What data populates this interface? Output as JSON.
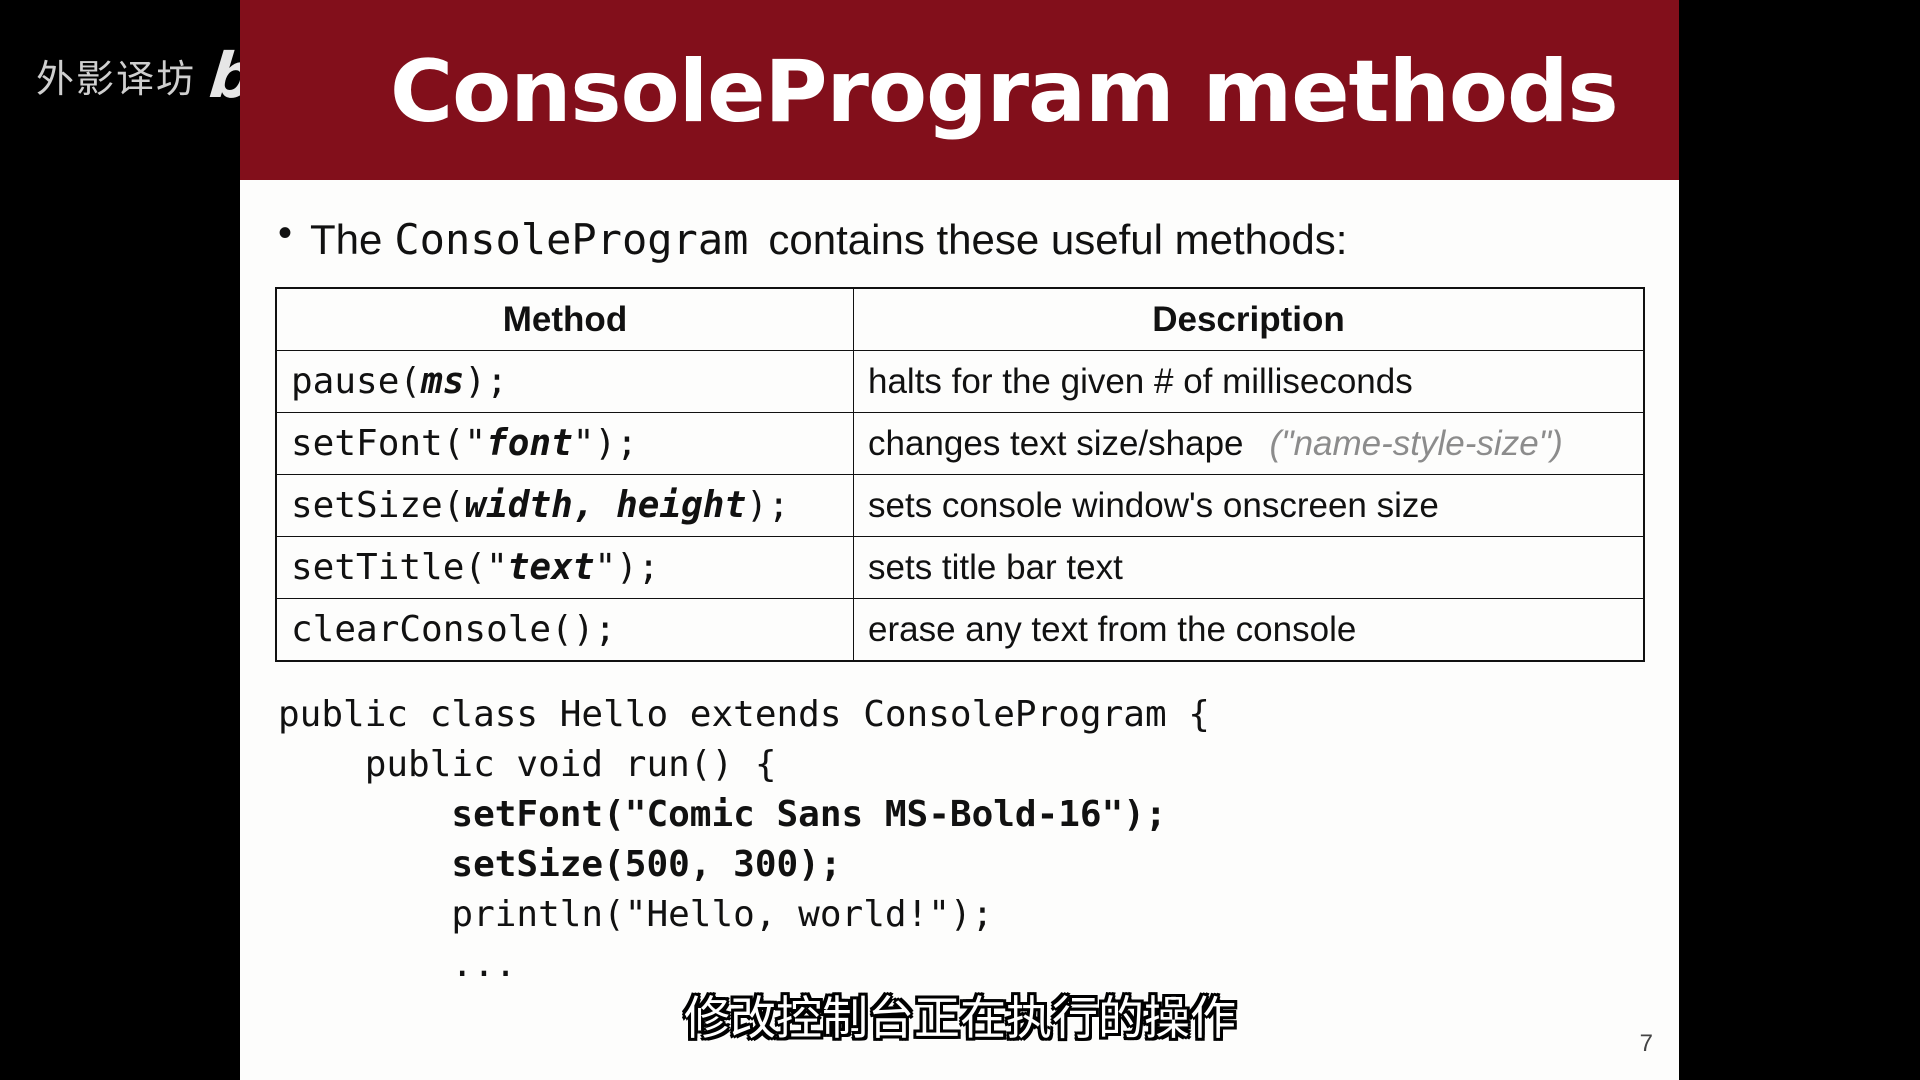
{
  "watermark": {
    "channel": "外影译坊",
    "logo": "bilibili"
  },
  "slide": {
    "title": "ConsoleProgram methods",
    "bullet": {
      "before": "The",
      "code": "ConsoleProgram",
      "after": "contains these useful methods:"
    },
    "table": {
      "headers": [
        "Method",
        "Description"
      ],
      "rows": [
        {
          "method": {
            "pre": "pause(",
            "arg": "ms",
            "post": ");"
          },
          "description": "halts for the given # of milliseconds",
          "note": ""
        },
        {
          "method": {
            "pre": "setFont(\"",
            "arg": "font",
            "post": "\");"
          },
          "description": "changes text size/shape",
          "note": "(\"name-style-size\")"
        },
        {
          "method": {
            "pre": "setSize(",
            "arg": "width, height",
            "post": ");"
          },
          "description": "sets console window's onscreen size",
          "note": ""
        },
        {
          "method": {
            "pre": "setTitle(\"",
            "arg": "text",
            "post": "\");"
          },
          "description": "sets title bar text",
          "note": ""
        },
        {
          "method": {
            "pre": "clearConsole();",
            "arg": "",
            "post": ""
          },
          "description": "erase any text from the console",
          "note": ""
        }
      ]
    },
    "code_lines": [
      {
        "text": "public class Hello extends ConsoleProgram {",
        "bold": false
      },
      {
        "text": "    public void run() {",
        "bold": false
      },
      {
        "text": "        setFont(\"Comic Sans MS-Bold-16\");",
        "bold": true
      },
      {
        "text": "        setSize(500, 300);",
        "bold": true
      },
      {
        "text": "        println(\"Hello, world!\");",
        "bold": false
      },
      {
        "text": "        ...",
        "bold": false
      }
    ],
    "page_number": "7"
  },
  "subtitle": "修改控制台正在执行的操作"
}
